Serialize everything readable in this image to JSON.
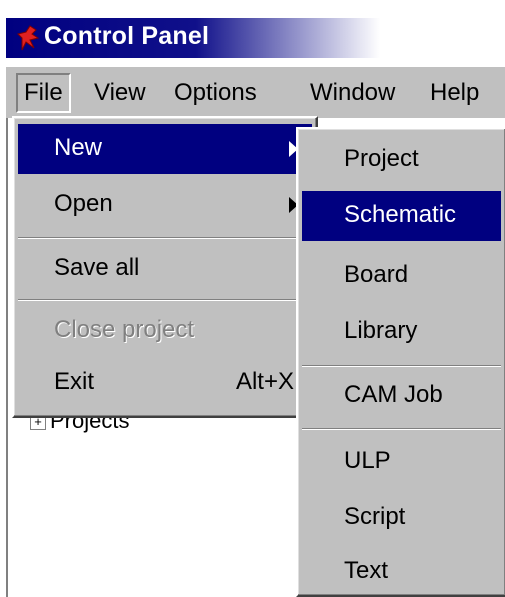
{
  "window": {
    "title": "Control Panel"
  },
  "menubar": {
    "file": "File",
    "view": "View",
    "options": "Options",
    "window": "Window",
    "help": "Help"
  },
  "file_menu": {
    "new": "New",
    "open": "Open",
    "save_all": "Save all",
    "close_project": "Close project",
    "exit": "Exit",
    "exit_shortcut": "Alt+X"
  },
  "new_submenu": {
    "project": "Project",
    "schematic": "Schematic",
    "board": "Board",
    "library": "Library",
    "cam_job": "CAM Job",
    "ulp": "ULP",
    "script": "Script",
    "text": "Text"
  },
  "tree": {
    "projects": "Projects"
  },
  "colors": {
    "title_gradient_start": "#000080",
    "menu_face": "#c0c0c0",
    "highlight": "#000080",
    "highlight_text": "#ffffff",
    "disabled_text": "#808080",
    "app_icon": "#e02020"
  },
  "icons": {
    "app": "eagle-app-icon",
    "submenu": "submenu-arrow-icon",
    "expander": "tree-expand-icon"
  }
}
